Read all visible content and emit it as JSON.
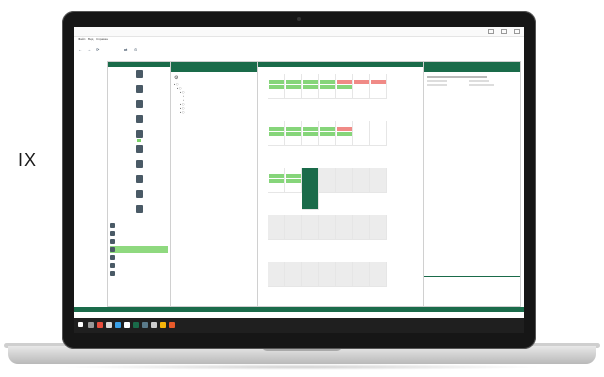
{
  "side_text": "IX",
  "app": {
    "window_title": "",
    "menu": [
      "Файл",
      "Вид",
      "Справка"
    ],
    "toolbar": {
      "back": "←",
      "forward": "→",
      "refresh_label": "",
      "icons": [
        "back-icon",
        "forward-icon",
        "refresh-icon",
        "sync-icon",
        "help-icon"
      ]
    },
    "left_panel": {
      "header": "",
      "nav_items": [
        "",
        "",
        "",
        "",
        "",
        "",
        "",
        "",
        "",
        ""
      ],
      "active_nav_index": 4,
      "list_items": [
        "",
        "",
        "",
        "",
        "",
        "",
        ""
      ],
      "active_list_index": 3
    },
    "tree_panel": {
      "header": ""
    },
    "calendar": {
      "day_headers": [
        "",
        "",
        "",
        "",
        "",
        "",
        ""
      ],
      "week_numbers": [
        "",
        "",
        "",
        "",
        ""
      ]
    },
    "right_panel": {
      "header": ""
    },
    "colors": {
      "brand_green": "#1a6b4a",
      "event_green": "#86d57a",
      "event_red": "#f08a86",
      "active_green": "#8fd97f"
    }
  },
  "taskbar": {
    "time": "",
    "date": ""
  }
}
